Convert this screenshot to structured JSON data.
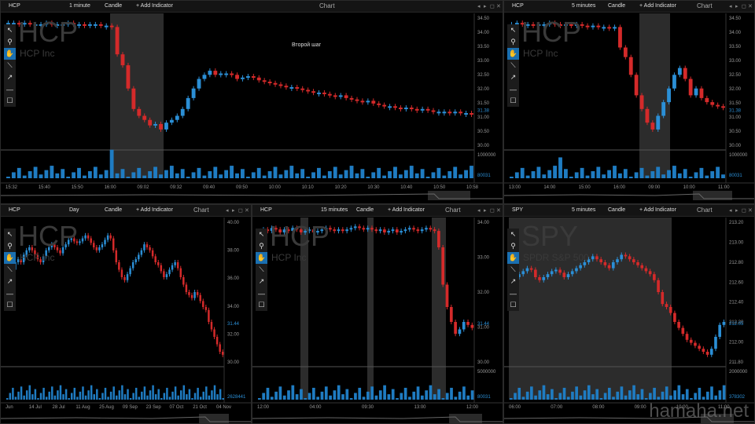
{
  "panels": [
    {
      "symbol": "HCP",
      "interval": "1 minute",
      "chart_type": "Candle",
      "add_indicator": "+ Add Indicator",
      "title": "Chart",
      "company": "HCP Inc",
      "prices": [
        "34.50",
        "34.00",
        "33.50",
        "33.00",
        "32.50",
        "32.00",
        "31.50",
        "31.00",
        "30.50",
        "30.00"
      ],
      "last_price": "31.38",
      "vol_top": "1000000",
      "vol_last": "80031",
      "times": [
        "15:32",
        "15:40",
        "15:50",
        "16:00",
        "09:02",
        "09:32",
        "09:40",
        "09:50",
        "10:00",
        "10:10",
        "10:20",
        "10:30",
        "10:40",
        "10:50",
        "10:58"
      ],
      "annotation": "Второй шаг"
    },
    {
      "symbol": "HCP",
      "interval": "5 minutes",
      "chart_type": "Candle",
      "add_indicator": "+ Add Indicator",
      "title": "Chart",
      "company": "HCP Inc",
      "prices": [
        "34.50",
        "34.00",
        "33.50",
        "33.00",
        "32.50",
        "32.00",
        "31.50",
        "31.00",
        "30.50",
        "30.00"
      ],
      "last_price": "31.38",
      "vol_top": "1000000",
      "vol_last": "80031",
      "times": [
        "13:00",
        "14:00",
        "15:00",
        "16:00",
        "09:00",
        "10:00",
        "11:00"
      ]
    },
    {
      "symbol": "HCP",
      "interval": "Day",
      "chart_type": "Candle",
      "add_indicator": "+ Add Indicator",
      "title": "Chart",
      "company": "HCP Inc",
      "prices": [
        "40.00",
        "38.00",
        "36.00",
        "34.00",
        "32.00",
        "30.00"
      ],
      "last_price": "31.44",
      "vol_top": "",
      "vol_last": "2628441",
      "times": [
        "Jun",
        "14 Jul",
        "28 Jul",
        "11 Aug",
        "25 Aug",
        "09 Sep",
        "23 Sep",
        "07 Oct",
        "21 Oct",
        "04 Nov"
      ]
    },
    {
      "symbol": "HCP",
      "interval": "15 minutes",
      "chart_type": "Candle",
      "add_indicator": "+ Add Indicator",
      "title": "Chart",
      "company": "HCP Inc",
      "prices": [
        "34.00",
        "33.00",
        "32.00",
        "31.00",
        "30.00"
      ],
      "last_price": "31.44",
      "vol_top": "5000000",
      "vol_last": "80031",
      "times": [
        "12:00",
        "04:00",
        "09:30",
        "13:00",
        "12:00"
      ]
    },
    {
      "symbol": "SPY",
      "interval": "5 minutes",
      "chart_type": "Candle",
      "add_indicator": "+ Add Indicator",
      "title": "Chart",
      "company": "SPDR S&P 500",
      "prices": [
        "213.20",
        "213.00",
        "212.80",
        "212.60",
        "212.40",
        "212.20",
        "212.00",
        "211.80"
      ],
      "last_price": "212.05",
      "vol_top": "2000000",
      "vol_last": "378302",
      "times": [
        "06:00",
        "07:00",
        "08:00",
        "09:00",
        "10:00",
        "11:00"
      ]
    }
  ],
  "tools": [
    "cursor-icon",
    "zoom-icon",
    "hand-icon",
    "line-icon",
    "arrow-icon",
    "hline-icon",
    "rect-icon"
  ],
  "watermark": "hamaha.net",
  "colors": {
    "up": "#2b8fd6",
    "down": "#d42a2a",
    "highlight": "#3a3a3a",
    "grid": "#262626"
  }
}
